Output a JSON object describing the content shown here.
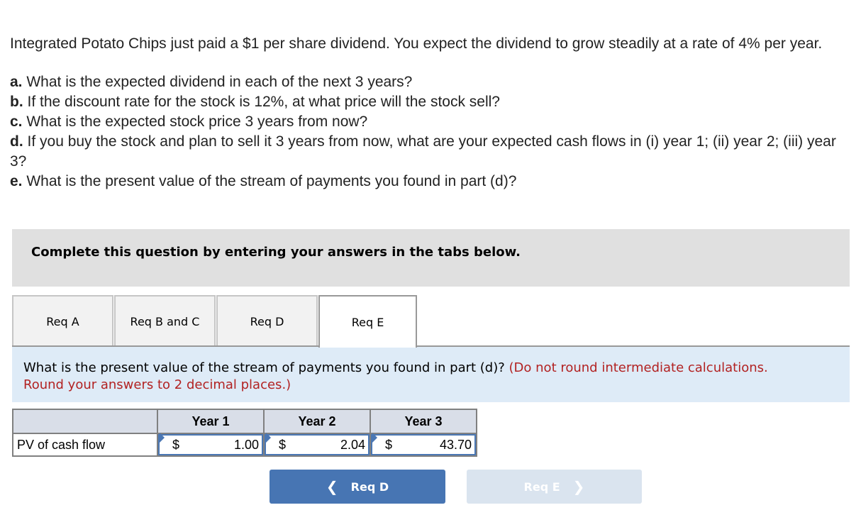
{
  "question": {
    "intro": "Integrated Potato Chips just paid a $1 per share dividend. You expect the dividend to grow steadily at a rate of 4% per year.",
    "parts": [
      {
        "letter": "a.",
        "text": " What is the expected dividend in each of the next 3 years?"
      },
      {
        "letter": "b.",
        "text": " If the discount rate for the stock is 12%, at what price will the stock sell?"
      },
      {
        "letter": "c.",
        "text": " What is the expected stock price 3 years from now?"
      },
      {
        "letter": "d.",
        "text": " If you buy the stock and plan to sell it 3 years from now, what are your expected cash flows in (i) year 1; (ii) year 2; (iii) year 3?"
      },
      {
        "letter": "e.",
        "text": " What is the present value of the stream of payments you found in part (d)?"
      }
    ]
  },
  "instruction": "Complete this question by entering your answers in the tabs below.",
  "tabs": [
    {
      "label": "Req A",
      "active": false
    },
    {
      "label": "Req B and C",
      "active": false
    },
    {
      "label": "Req D",
      "active": false
    },
    {
      "label": "Req E",
      "active": true
    }
  ],
  "prompt": {
    "question": "What is the present value of the stream of payments you found in part (d)? ",
    "note_line1": "(Do not round intermediate calculations. ",
    "note_line2": "Round your answers to 2 decimal places.)"
  },
  "table": {
    "headers": [
      "",
      "Year 1",
      "Year 2",
      "Year 3"
    ],
    "rows": [
      {
        "label": "PV of cash flow",
        "cells": [
          {
            "currency": "$",
            "value": "1.00"
          },
          {
            "currency": "$",
            "value": "2.04"
          },
          {
            "currency": "$",
            "value": "43.70"
          }
        ]
      }
    ]
  },
  "nav": {
    "prev_label": "Req D",
    "prev_icon": "chevron-left-icon",
    "next_label": "Req E",
    "next_icon": "chevron-right-icon"
  },
  "colors": {
    "accent_blue": "#4775b3",
    "disabled_blue": "#dae4ef",
    "note_red": "#b22222",
    "panel_blue": "#deebf7",
    "instruction_gray": "#e0e0e0"
  }
}
